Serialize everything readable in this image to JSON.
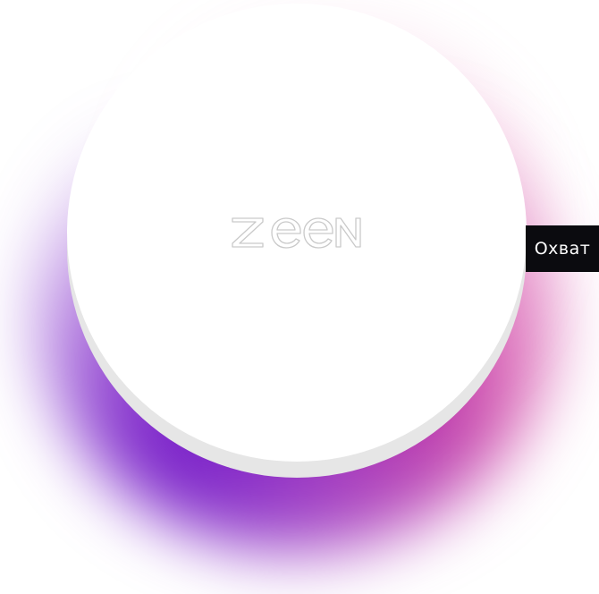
{
  "logo": {
    "text": "zeen",
    "icon": "zeen-logo-outline"
  },
  "badge": {
    "label": "Охват"
  },
  "colors": {
    "background": "#ffffff",
    "disc": "#ffffff",
    "disc_rim": "#e6e6e6",
    "glow_purple": "#6e14c8",
    "glow_magenta": "#c82896",
    "badge_bg": "#0b0b0f",
    "badge_text": "#ffffff"
  }
}
